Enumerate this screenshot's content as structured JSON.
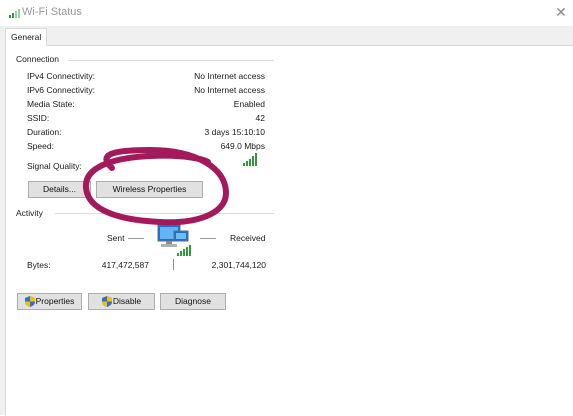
{
  "window": {
    "title": "Wi-Fi Status",
    "close_glyph": "✕"
  },
  "tabs": [
    {
      "label": "General"
    }
  ],
  "connection": {
    "heading": "Connection",
    "rows": [
      {
        "label": "IPv4 Connectivity:",
        "value": "No Internet access"
      },
      {
        "label": "IPv6 Connectivity:",
        "value": "No Internet access"
      },
      {
        "label": "Media State:",
        "value": "Enabled"
      },
      {
        "label": "SSID:",
        "value": "42"
      },
      {
        "label": "Duration:",
        "value": "3 days 15:10:10"
      },
      {
        "label": "Speed:",
        "value": "649.0 Mbps"
      }
    ],
    "signal_quality_label": "Signal Quality:",
    "signal_bars_lit": 5,
    "signal_bars_total": 5,
    "details_button": "Details...",
    "wireless_properties_button": "Wireless Properties"
  },
  "activity": {
    "heading": "Activity",
    "sent_label": "Sent",
    "received_label": "Received",
    "bytes_label": "Bytes:",
    "bytes_sent": "417,472,587",
    "bytes_received": "2,301,744,120"
  },
  "buttons": {
    "properties": "Properties",
    "disable": "Disable",
    "diagnose": "Diagnose"
  },
  "colors": {
    "signal_green": "#2f9a3c",
    "annotation_magenta": "#a3195b",
    "shield_blue": "#2f6fd0",
    "shield_yellow": "#f2c300"
  }
}
